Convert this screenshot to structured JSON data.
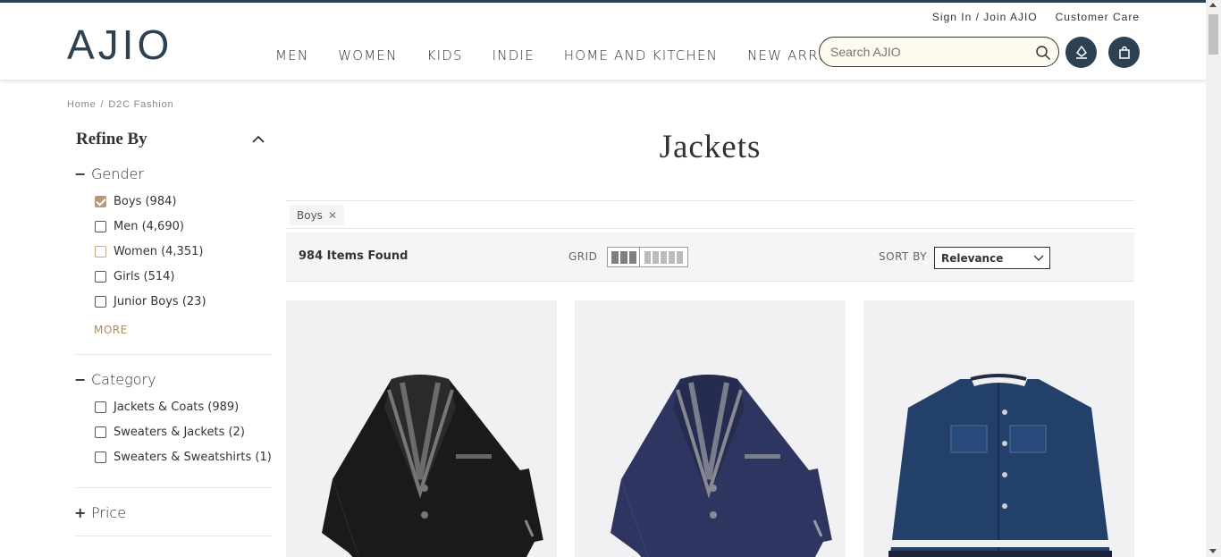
{
  "header": {
    "logo": "AJIO",
    "sign_in": "Sign In / Join AJIO",
    "customer_care": "Customer Care",
    "nav": [
      "MEN",
      "WOMEN",
      "KIDS",
      "INDIE",
      "HOME AND KITCHEN",
      "NEW ARRIVALS"
    ],
    "search_placeholder": "Search AJIO",
    "icons": [
      "search-icon",
      "user-icon",
      "bag-icon"
    ]
  },
  "breadcrumb": [
    "Home",
    "D2C Fashion"
  ],
  "sidebar": {
    "title": "Refine By",
    "gender": {
      "label": "Gender",
      "options": [
        {
          "label": "Boys (984)",
          "checked": true
        },
        {
          "label": "Men (4,690)",
          "checked": false
        },
        {
          "label": "Women (4,351)",
          "checked": false
        },
        {
          "label": "Girls (514)",
          "checked": false
        },
        {
          "label": "Junior Boys (23)",
          "checked": false
        }
      ],
      "more": "MORE"
    },
    "category": {
      "label": "Category",
      "options": [
        {
          "label": "Jackets & Coats (989)",
          "checked": false
        },
        {
          "label": "Sweaters & Jackets (2)",
          "checked": false
        },
        {
          "label": "Sweaters & Sweatshirts (1)",
          "checked": false
        }
      ]
    },
    "price": {
      "label": "Price"
    }
  },
  "main": {
    "title": "Jackets",
    "active_filter": "Boys",
    "items_found": "984 Items Found",
    "grid_label": "GRID",
    "sort_label": "SORT BY",
    "sort_value": "Relevance"
  },
  "colors": {
    "brand": "#2c4152",
    "accent_tan": "#b59a7a",
    "card_bg": "#f1f0f2"
  },
  "products": [
    {
      "image": "black-blazer"
    },
    {
      "image": "navy-blazer"
    },
    {
      "image": "denim-jacket"
    }
  ]
}
